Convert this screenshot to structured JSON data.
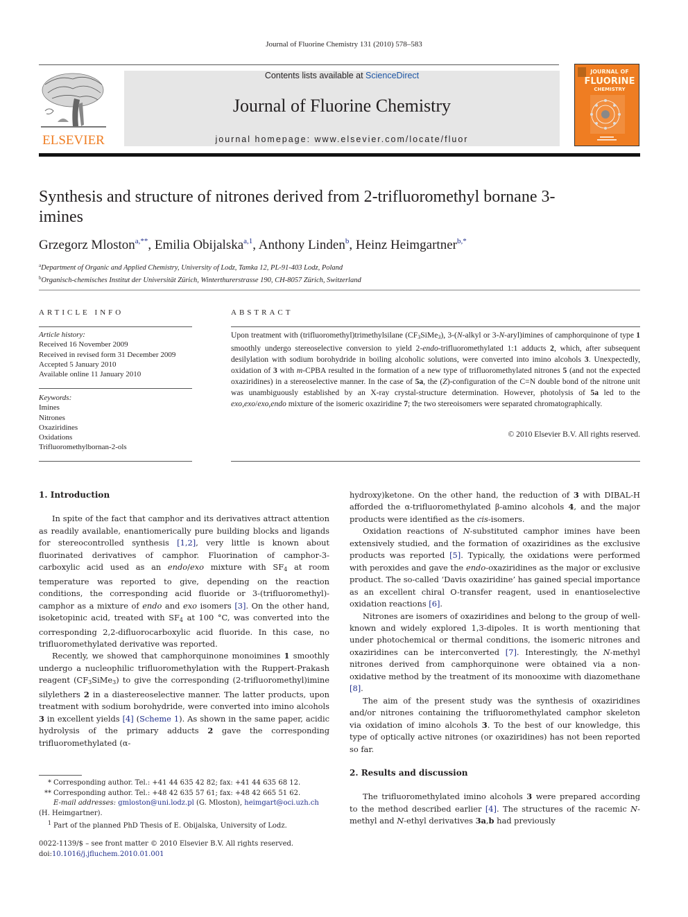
{
  "header": {
    "journal_ref": "Journal of Fluorine Chemistry 131 (2010) 578–583",
    "contents_prefix": "Contents lists available at ",
    "contents_link": "ScienceDirect",
    "journal_name": "Journal of Fluorine Chemistry",
    "homepage": "journal homepage: www.elsevier.com/locate/fluor",
    "publisher_logo_text": "ELSEVIER",
    "cover": {
      "line1": "JOURNAL OF",
      "line2": "FLUORINE",
      "line3": "CHEMISTRY"
    },
    "colors": {
      "elsevier_orange": "#ef7d22",
      "link_blue": "#1f2d8a",
      "sciencedirect_blue": "#1d56a5",
      "banner_gray": "#e6e6e6"
    }
  },
  "article": {
    "title": "Synthesis and structure of nitrones derived from 2-trifluoromethyl bornane 3-imines",
    "authors": [
      {
        "name": "Grzegorz Mloston",
        "sup": "a,**"
      },
      {
        "name": "Emilia Obijalska",
        "sup": "a,1"
      },
      {
        "name": "Anthony Linden",
        "sup": "b"
      },
      {
        "name": "Heinz Heimgartner",
        "sup": "b,*"
      }
    ],
    "affiliations": [
      {
        "mark": "a",
        "text": "Department of Organic and Applied Chemistry, University of Lodz, Tamka 12, PL-91-403 Lodz, Poland"
      },
      {
        "mark": "b",
        "text": "Organisch-chemisches Institut der Universität Zürich, Winterthurerstrasse 190, CH-8057 Zürich, Switzerland"
      }
    ]
  },
  "article_info": {
    "heading": "ARTICLE INFO",
    "history_label": "Article history:",
    "history": [
      "Received 16 November 2009",
      "Received in revised form 31 December 2009",
      "Accepted 5 January 2010",
      "Available online 11 January 2010"
    ],
    "keywords_label": "Keywords:",
    "keywords": [
      "Imines",
      "Nitrones",
      "Oxaziridines",
      "Oxidations",
      "Trifluoromethylbornan-2-ols"
    ]
  },
  "abstract": {
    "heading": "ABSTRACT",
    "copyright": "© 2010 Elsevier B.V. All rights reserved."
  },
  "sections": {
    "intro_heading": "1.  Introduction",
    "results_heading": "2.  Results and discussion"
  },
  "citations": {
    "c12": "[1,2]",
    "c3": "[3]",
    "c4": "[4]",
    "scheme1": "Scheme 1",
    "c5": "[5]",
    "c6": "[6]",
    "c7": "[7]",
    "c8": "[8]"
  },
  "footnotes": {
    "star1_mark": "*",
    "star1": "Corresponding author. Tel.: +41 44 635 42 82; fax: +41 44 635 68 12.",
    "star2_mark": "**",
    "star2": "Corresponding author. Tel.: +48 42 635 57 61; fax: +48 42 665 51 62.",
    "email_label": "E-mail addresses:",
    "email1": "gmloston@uni.lodz.pl",
    "email1_owner": "(G. Mloston),",
    "email2": "heimgart@oci.uzh.ch",
    "email2_owner": "(H. Heimgartner).",
    "note1_mark": "1",
    "note1": "Part of the planned PhD Thesis of E. Obijalska, University of Lodz.",
    "front_matter": "0022-1139/$ – see front matter © 2010 Elsevier B.V. All rights reserved.",
    "doi_prefix": "doi:",
    "doi": "10.1016/j.jfluchem.2010.01.001"
  }
}
